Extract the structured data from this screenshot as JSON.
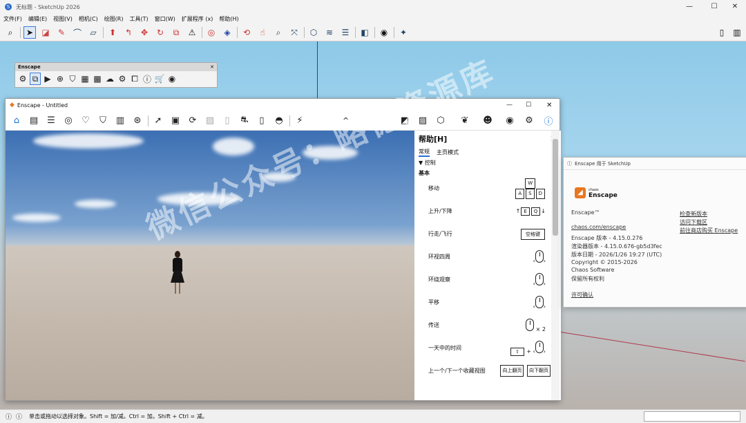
{
  "sketchup": {
    "title": "无标题 - SketchUp 2026",
    "window_controls": [
      "—",
      "☐",
      "✕"
    ],
    "menu": [
      "文件(F)",
      "编辑(E)",
      "视图(V)",
      "相机(C)",
      "绘图(R)",
      "工具(T)",
      "窗口(W)",
      "扩展程序 (x)",
      "帮助(H)"
    ],
    "status_text": "单击或拖动以选择对象。Shift = 加/减。Ctrl = 加。Shift + Ctrl = 减。"
  },
  "enscape_toolbar": {
    "title": "Enscape",
    "close": "✕"
  },
  "enscape_window": {
    "title": "Enscape - Untitled",
    "window_controls": [
      "—",
      "☐",
      "✕"
    ],
    "chevron": "^"
  },
  "help_panel": {
    "title": "帮助[H]",
    "close": "✕",
    "tabs": [
      "常规",
      "主页模式"
    ],
    "section": "控制",
    "subsection": "基本",
    "rows": [
      {
        "label": "移动",
        "keys": [
          "W",
          "A",
          "S",
          "D"
        ]
      },
      {
        "label": "上升/下降",
        "keys": [
          "E",
          "Q"
        ]
      },
      {
        "label": "行走/飞行",
        "keys": [
          "空格键"
        ]
      },
      {
        "label": "环视四周",
        "keys": []
      },
      {
        "label": "环绕观察",
        "keys": []
      },
      {
        "label": "平移",
        "keys": []
      },
      {
        "label": "传送",
        "keys": [
          "× 2"
        ]
      },
      {
        "label": "一天中的时间",
        "keys": [
          "+"
        ]
      },
      {
        "label": "上一个/下一个收藏视图",
        "keys": [
          "向上翻页",
          "向下翻页"
        ]
      }
    ]
  },
  "about": {
    "title": "Enscape 用于 SketchUp",
    "brand_small": "chaos",
    "brand": "Enscape",
    "product": "Enscape™",
    "site": "chaos.com/enscape",
    "version": "Enscape 版本 - 4.15.0.276",
    "renderer": "渲染器版本 - 4.15.0.676-gb5d3fec",
    "date": "版本日期 - 2026/1/26 19:27 (UTC)",
    "copyright": "Copyright © 2015-2026",
    "company": "Chaos Software",
    "rights": "保留所有权利",
    "license": "许可确认",
    "links": [
      "检查新版本",
      "访问下载区",
      "前往商店购买 Enscape"
    ]
  },
  "watermark": "微信公众号：略德资源库",
  "icons": [
    "search-icon",
    "select-arrow-icon",
    "eraser-icon",
    "pencil-icon",
    "home-icon",
    "help-icon",
    "settings-icon",
    "close-icon",
    "mouse-icon"
  ]
}
